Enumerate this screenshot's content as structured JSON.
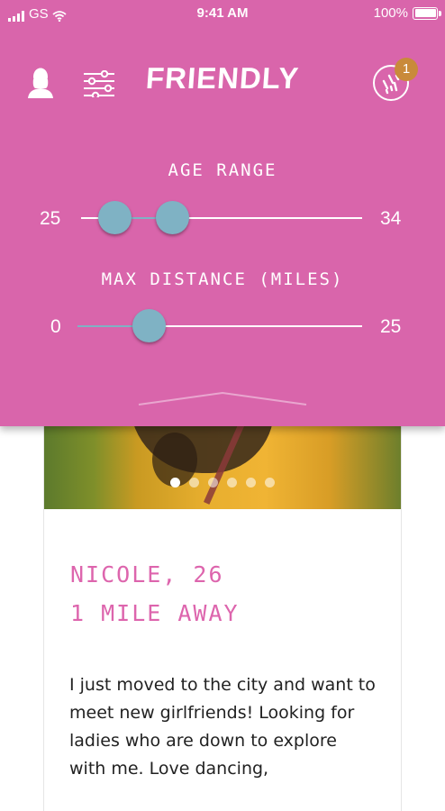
{
  "status_bar": {
    "carrier": "GS",
    "time": "9:41 AM",
    "battery": "100%"
  },
  "header": {
    "logo": "FRIENDLY",
    "notification_count": "1",
    "icons": [
      "profile-icon",
      "filter-sliders-icon",
      "match-icon"
    ]
  },
  "filters": {
    "age_range": {
      "label": "AGE RANGE",
      "min_label": "25",
      "max_label": "34",
      "selected_low": 25,
      "selected_high": 27
    },
    "max_distance": {
      "label": "MAX DISTANCE (MILES)",
      "min_label": "0",
      "max_label": "25",
      "selected": 6
    }
  },
  "profile": {
    "name_age": "NICOLE, 26",
    "distance": "1 MILE AWAY",
    "bio": "I just moved to the city and want to meet new girlfriends!  Looking for ladies who are down to explore with me.  Love dancing,",
    "photo_count": 6,
    "active_photo": 1
  },
  "colors": {
    "panel": "#d965ab",
    "slider_thumb": "#7fb2c4",
    "accent_text": "#dd65ad",
    "badge": "#c98a3a"
  }
}
